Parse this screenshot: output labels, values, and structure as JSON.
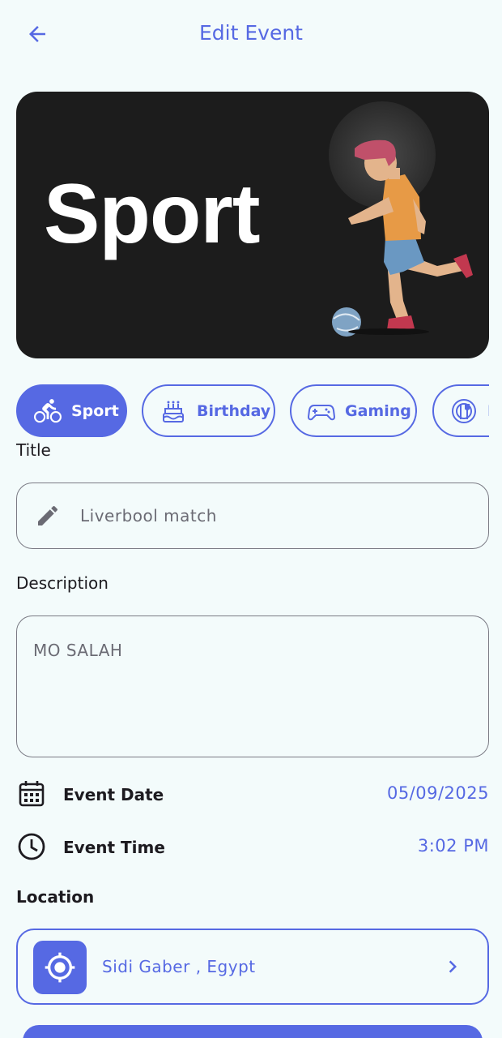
{
  "header": {
    "title": "Edit Event"
  },
  "banner": {
    "text": "Sport"
  },
  "categories": [
    {
      "label": "Sport",
      "icon": "bicycle-icon",
      "active": true
    },
    {
      "label": "Birthday",
      "icon": "cake-icon",
      "active": false
    },
    {
      "label": "Gaming",
      "icon": "gamepad-icon",
      "active": false
    },
    {
      "label": "E",
      "icon": "dining-icon",
      "active": false
    }
  ],
  "form": {
    "title_label": "Title",
    "title_value": "Liverbool match",
    "description_label": "Description",
    "description_value": "MO SALAH",
    "date_label": "Event Date",
    "date_value": "05/09/2025",
    "time_label": "Event Time",
    "time_value": "3:02 PM",
    "location_label": "Location",
    "location_value": "Sidi Gaber , Egypt"
  },
  "colors": {
    "accent": "#5669e3",
    "background": "#f3fbfb",
    "banner": "#1c1c1c"
  }
}
